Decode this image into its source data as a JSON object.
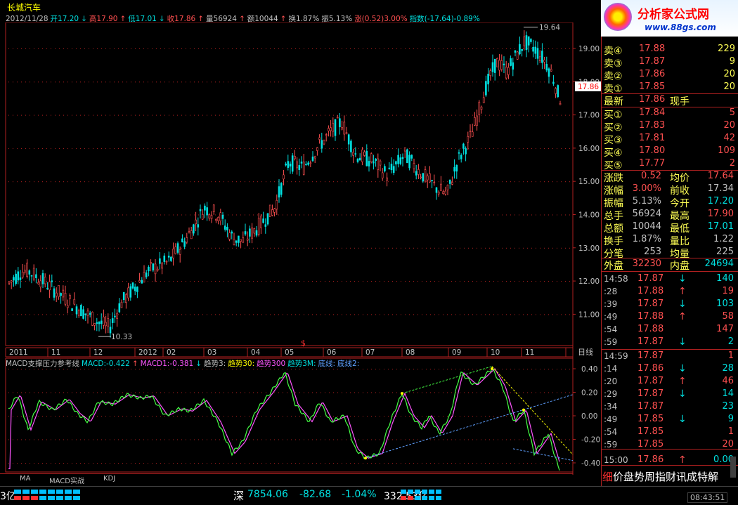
{
  "stock": {
    "name": "长城汽车",
    "info": [
      {
        "t": "2012/11/28",
        "c": "w"
      },
      {
        "t": "开17.20",
        "c": "g"
      },
      {
        "t": "↓",
        "c": "g"
      },
      {
        "t": "高17.90",
        "c": "r"
      },
      {
        "t": "↑",
        "c": "r"
      },
      {
        "t": "低17.01",
        "c": "g"
      },
      {
        "t": "↓",
        "c": "g"
      },
      {
        "t": "收17.86",
        "c": "r"
      },
      {
        "t": "↑",
        "c": "r"
      },
      {
        "t": "量56924",
        "c": "w"
      },
      {
        "t": "↑",
        "c": "r"
      },
      {
        "t": "额10044",
        "c": "w"
      },
      {
        "t": "↑",
        "c": "r"
      },
      {
        "t": "换1.87%",
        "c": "w"
      },
      {
        "t": "振5.13%",
        "c": "w"
      },
      {
        "t": "涨(0.52)3.00%",
        "c": "r"
      },
      {
        "t": "指数(-17.64)-0.89%",
        "c": "g"
      }
    ],
    "price_axis": [
      "19.00",
      "18.00",
      "17.00",
      "16.00",
      "15.00",
      "14.00",
      "13.00",
      "12.00",
      "11.00"
    ],
    "current_price_tag": "17.86",
    "high_label": "19.64",
    "low_label": "10.33",
    "time_axis": [
      "2011",
      "11",
      "12",
      "2012",
      "02",
      "03",
      "04",
      "05",
      "06",
      "07",
      "08",
      "09",
      "10",
      "11"
    ],
    "period": "日线",
    "macd_header": [
      {
        "t": "MACD支撑压力参考线",
        "c": "w"
      },
      {
        "t": "MACD:-0.422",
        "c": "g"
      },
      {
        "t": "↑",
        "c": "r"
      },
      {
        "t": "MACD1:-0.381",
        "c": "p"
      },
      {
        "t": "↓",
        "c": "g"
      },
      {
        "t": "趋势3:",
        "c": "w"
      },
      {
        "t": "趋势30:",
        "c": "y"
      },
      {
        "t": "趋势300",
        "c": "p"
      },
      {
        "t": "趋势3M:",
        "c": "g"
      },
      {
        "t": "底线:",
        "c": "b"
      },
      {
        "t": "底线2:",
        "c": "b"
      }
    ],
    "macd_axis": [
      "0.40",
      "0.20",
      "0.00",
      "-0.20",
      "-0.40"
    ],
    "tabs": [
      "MA",
      "MACD实战",
      "KDJ"
    ]
  },
  "panel": {
    "logo": "分析家公式网",
    "logo_url": "www.88gs.com",
    "sells": [
      {
        "label": "卖④",
        "price": "17.88",
        "vol": "229"
      },
      {
        "label": "卖③",
        "price": "17.87",
        "vol": "9"
      },
      {
        "label": "卖②",
        "price": "17.86",
        "vol": "20"
      },
      {
        "label": "卖①",
        "price": "17.85",
        "vol": "20"
      }
    ],
    "latest": {
      "label": "最新",
      "price": "17.86",
      "label2": "现手"
    },
    "buys": [
      {
        "label": "买①",
        "price": "17.84",
        "vol": "5"
      },
      {
        "label": "买②",
        "price": "17.83",
        "vol": "20"
      },
      {
        "label": "买③",
        "price": "17.81",
        "vol": "42"
      },
      {
        "label": "买④",
        "price": "17.80",
        "vol": "109"
      },
      {
        "label": "买⑤",
        "price": "17.77",
        "vol": "2"
      }
    ],
    "stats": [
      {
        "l1": "涨跌",
        "v1": "0.52",
        "c1": "r",
        "l2": "均价",
        "v2": "17.64",
        "c2": "r"
      },
      {
        "l1": "涨幅",
        "v1": "3.00%",
        "c1": "r",
        "l2": "前收",
        "v2": "17.34",
        "c2": "w"
      },
      {
        "l1": "振幅",
        "v1": "5.13%",
        "c1": "w",
        "l2": "今开",
        "v2": "17.20",
        "c2": "g"
      },
      {
        "l1": "总手",
        "v1": "56924",
        "c1": "w",
        "l2": "最高",
        "v2": "17.90",
        "c2": "r"
      },
      {
        "l1": "总额",
        "v1": "10044",
        "c1": "w",
        "l2": "最低",
        "v2": "17.01",
        "c2": "g"
      },
      {
        "l1": "换手",
        "v1": "1.87%",
        "c1": "w",
        "l2": "量比",
        "v2": "1.22",
        "c2": "w"
      },
      {
        "l1": "分笔",
        "v1": "253",
        "c1": "w",
        "l2": "均量",
        "v2": "225",
        "c2": "w"
      }
    ],
    "outer": {
      "l1": "外盘",
      "v1": "32230",
      "l2": "内盘",
      "v2": "24694"
    },
    "ticks": [
      {
        "t": "14:58",
        "p": "17.87",
        "a": "↓",
        "ac": "g",
        "n": "140",
        "nc": "g"
      },
      {
        "t": ":28",
        "p": "17.88",
        "a": "↑",
        "ac": "r",
        "n": "19",
        "nc": "r"
      },
      {
        "t": ":39",
        "p": "17.87",
        "a": "↓",
        "ac": "g",
        "n": "103",
        "nc": "g"
      },
      {
        "t": ":49",
        "p": "17.88",
        "a": "↑",
        "ac": "r",
        "n": "58",
        "nc": "r"
      },
      {
        "t": ":54",
        "p": "17.88",
        "a": "",
        "ac": "w",
        "n": "147",
        "nc": "r"
      },
      {
        "t": ":59",
        "p": "17.87",
        "a": "↓",
        "ac": "g",
        "n": "2",
        "nc": "g"
      },
      {
        "t": "14:59",
        "p": "17.87",
        "a": "",
        "ac": "w",
        "n": "1",
        "nc": "r"
      },
      {
        "t": ":14",
        "p": "17.86",
        "a": "↓",
        "ac": "g",
        "n": "28",
        "nc": "g"
      },
      {
        "t": ":20",
        "p": "17.87",
        "a": "↑",
        "ac": "r",
        "n": "46",
        "nc": "r"
      },
      {
        "t": ":29",
        "p": "17.87",
        "a": "↓",
        "ac": "g",
        "n": "14",
        "nc": "g"
      },
      {
        "t": ":34",
        "p": "17.87",
        "a": "",
        "ac": "w",
        "n": "23",
        "nc": "g"
      },
      {
        "t": ":49",
        "p": "17.85",
        "a": "↓",
        "ac": "g",
        "n": "9",
        "nc": "g"
      },
      {
        "t": ":54",
        "p": "17.85",
        "a": "",
        "ac": "w",
        "n": "1",
        "nc": "r"
      },
      {
        "t": ":59",
        "p": "17.85",
        "a": "",
        "ac": "w",
        "n": "20",
        "nc": "r"
      },
      {
        "t": "15:00",
        "p": "17.86",
        "a": "↑",
        "ac": "r",
        "n": "0.00",
        "nc": "g"
      }
    ],
    "bottom_tabs": "价盘势周指财讯成特解",
    "bottom_tab0": "细"
  },
  "status": {
    "left": "3亿",
    "index_name": "深",
    "index_val": "7854.06",
    "index_chg": "-82.68",
    "index_pct": "-1.04%",
    "index_amt": "332.53亿",
    "time": "08:43:51"
  },
  "colors": {
    "up": "#ff5050",
    "down": "#00e0e0",
    "frame": "#b02020"
  }
}
